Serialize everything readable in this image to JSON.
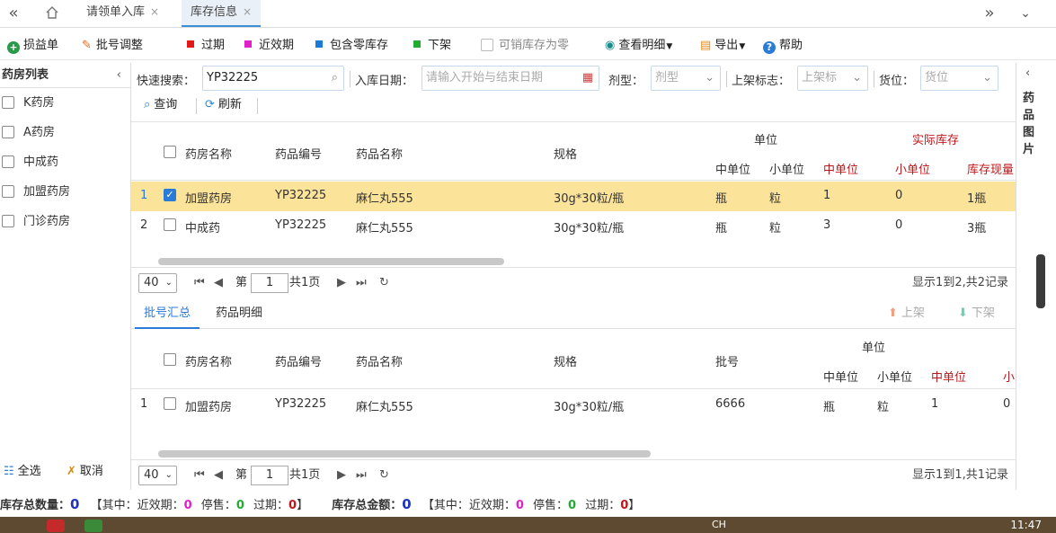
{
  "tabs": {
    "items": [
      {
        "label": "请领单入库"
      },
      {
        "label": "库存信息"
      }
    ]
  },
  "toolbar": {
    "loss_gain": "损益单",
    "batch_adjust": "批号调整",
    "expired": "过期",
    "near_expiry": "近效期",
    "include_zero": "包含零库存",
    "off_shelf": "下架",
    "sellable_zero": "可销库存为零",
    "view_detail": "查看明细",
    "export": "导出",
    "help": "帮助",
    "colors": {
      "expired": "#e01818",
      "near_expiry": "#e020c8",
      "include_zero": "#1a7ad8",
      "off_shelf": "#22aa33"
    }
  },
  "left_panel": {
    "title": "药房列表",
    "items": [
      {
        "label": "K药房"
      },
      {
        "label": "A药房"
      },
      {
        "label": "中成药"
      },
      {
        "label": "加盟药房"
      },
      {
        "label": "门诊药房"
      }
    ],
    "select_all": "全选",
    "cancel": "取消"
  },
  "filters": {
    "quick_search_label": "快速搜索：",
    "quick_search_value": "YP32225",
    "date_label": "入库日期：",
    "date_placeholder": "请输入开始与结束日期",
    "form_label": "剂型：",
    "form_placeholder": "剂型",
    "shelf_flag_label": "上架标志：",
    "shelf_flag_placeholder": "上架标",
    "location_label": "货位：",
    "location_placeholder": "货位",
    "query": "查询",
    "refresh": "刷新"
  },
  "grid1": {
    "headers": {
      "pharmacy": "药房名称",
      "code": "药品编号",
      "name": "药品名称",
      "spec": "规格",
      "unit_group": "单位",
      "stock_group": "实际库存",
      "mid_unit": "中单位",
      "small_unit": "小单位",
      "stock_mid": "中单位",
      "stock_small": "小单位",
      "stock_now": "库存现量"
    },
    "rows": [
      {
        "no": "1",
        "pharmacy": "加盟药房",
        "code": "YP32225",
        "name": "麻仁丸555",
        "spec": "30g*30粒/瓶",
        "mid_unit": "瓶",
        "small_unit": "粒",
        "stock_mid": "1",
        "stock_small": "0",
        "stock_now": "1瓶"
      },
      {
        "no": "2",
        "pharmacy": "中成药",
        "code": "YP32225",
        "name": "麻仁丸555",
        "spec": "30g*30粒/瓶",
        "mid_unit": "瓶",
        "small_unit": "粒",
        "stock_mid": "3",
        "stock_small": "0",
        "stock_now": "3瓶"
      }
    ]
  },
  "pager1": {
    "page_size": "40",
    "page_label": "第",
    "page": "1",
    "total_pages": "共1页",
    "summary": "显示1到2,共2记录"
  },
  "subtabs": {
    "batch_summary": "批号汇总",
    "drug_detail": "药品明细",
    "shelve": "上架",
    "unshelve": "下架"
  },
  "grid2": {
    "headers": {
      "pharmacy": "药房名称",
      "code": "药品编号",
      "name": "药品名称",
      "spec": "规格",
      "batch": "批号",
      "unit_group": "单位",
      "mid_unit": "中单位",
      "small_unit": "小单位",
      "stock_mid": "中单位",
      "stock_small_cut": "小"
    },
    "rows": [
      {
        "no": "1",
        "pharmacy": "加盟药房",
        "code": "YP32225",
        "name": "麻仁丸555",
        "spec": "30g*30粒/瓶",
        "batch": "6666",
        "mid_unit": "瓶",
        "small_unit": "粒",
        "stock_mid": "1",
        "stock_small": "0"
      }
    ]
  },
  "pager2": {
    "page_size": "40",
    "page_label": "第",
    "page": "1",
    "total_pages": "共1页",
    "summary": "显示1到1,共1记录"
  },
  "right_panel": {
    "title": "药品图片"
  },
  "status": {
    "qty_label": "库存总数量：",
    "qty": "0",
    "qty_detail_open": "【其中：近效期：",
    "qty_near": "0",
    "qty_stop_label": "停售：",
    "qty_stop": "0",
    "qty_exp_label": "过期：",
    "qty_exp": "0",
    "close": "】",
    "amt_label": "库存总金额：",
    "amt": "0",
    "amt_detail_open": "【其中：近效期：",
    "amt_near": "0",
    "amt_stop_label": "停售：",
    "amt_stop": "0",
    "amt_exp_label": "过期：",
    "amt_exp": "0",
    "near_color": "#e020c8",
    "stop_color": "#22aa33",
    "exp_color": "#c0161a"
  },
  "taskbar": {
    "clock": "11:47",
    "lang": "CH"
  }
}
